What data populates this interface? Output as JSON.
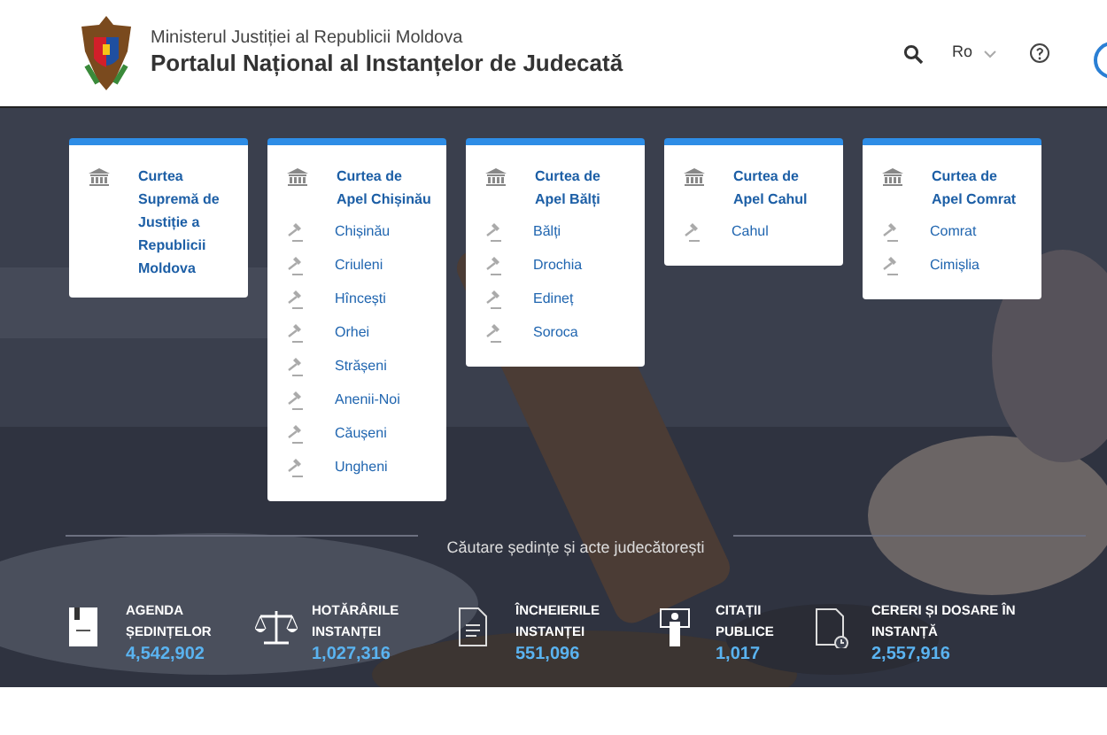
{
  "header": {
    "ministry": "Ministerul Justiției al Republicii Moldova",
    "title": "Portalul Național al Instanțelor de Judecată",
    "language": "Ro"
  },
  "courts": [
    {
      "title": "Curtea Supremă de Justiție a Republicii Moldova"
    },
    {
      "title": "Curtea de Apel Chișinău",
      "items": [
        "Chișinău",
        "Criuleni",
        "Hîncești",
        "Orhei",
        "Strășeni",
        "Anenii-Noi",
        "Căușeni",
        "Ungheni"
      ]
    },
    {
      "title": "Curtea de Apel Bălți",
      "items": [
        "Bălți",
        "Drochia",
        "Edineț",
        "Soroca"
      ]
    },
    {
      "title": "Curtea de Apel Cahul",
      "items": [
        "Cahul"
      ]
    },
    {
      "title": "Curtea de Apel Comrat",
      "items": [
        "Comrat",
        "Cimișlia"
      ]
    }
  ],
  "search_heading": "Căutare ședințe și acte judecătorești",
  "stats": [
    {
      "kind": "book",
      "label": "AGENDA ȘEDINȚELOR",
      "count": "4,542,902"
    },
    {
      "kind": "scales",
      "label": "HOTĂRÂRILE INSTANȚEI",
      "count": "1,027,316"
    },
    {
      "kind": "document",
      "label": "ÎNCHEIERILE INSTANȚEI",
      "count": "551,096"
    },
    {
      "kind": "person",
      "label": "CITAȚII PUBLICE",
      "count": "1,017"
    },
    {
      "kind": "clockdoc",
      "label": "CERERI ȘI DOSARE ÎN INSTANȚĂ",
      "count": "2,557,916"
    }
  ]
}
